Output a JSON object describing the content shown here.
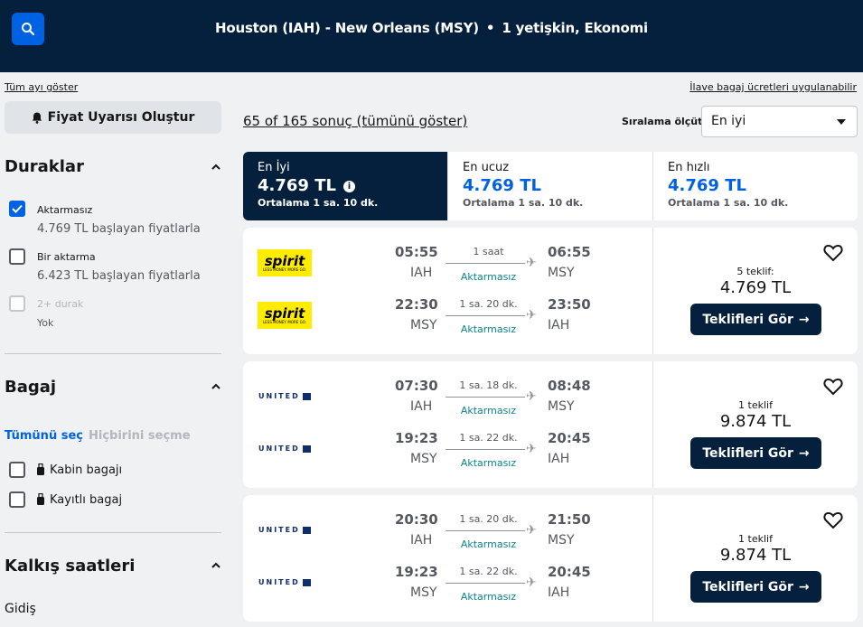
{
  "header": {
    "route": "Houston (IAH) - New Orleans (MSY)",
    "passengers": "1 yetişkin, Ekonomi"
  },
  "sidebar": {
    "show_month": "Tüm ayı göster",
    "alert_button": "Fiyat Uyarısı Oluştur",
    "stops_title": "Duraklar",
    "stops": [
      {
        "label": "Aktarmasız",
        "sub": "4.769 TL başlayan fiyatlarla",
        "checked": true
      },
      {
        "label": "Bir aktarma",
        "sub": "6.423 TL başlayan fiyatlarla",
        "checked": false
      },
      {
        "label": "2+ durak",
        "sub": "Yok",
        "checked": false,
        "disabled": true
      }
    ],
    "baggage_title": "Bagaj",
    "select_all": "Tümünü seç",
    "select_none": "Hiçbirini seçme",
    "baggage": [
      {
        "label": "Kabin bagajı"
      },
      {
        "label": "Kayıtlı bagaj"
      }
    ],
    "departure_title": "Kalkış saatleri",
    "departure_sub": "Gidiş"
  },
  "results": {
    "extra_fees": "İlave bagaj ücretleri uygulanabilir",
    "count": "65 of 165 sonuç (tümünü göster)",
    "sort_label": "Sıralama ölçütü",
    "sort_value": "En iyi"
  },
  "tabs": [
    {
      "label": "En İyi",
      "price": "4.769 TL",
      "avg": "Ortalama 1 sa. 10 dk."
    },
    {
      "label": "En ucuz",
      "price": "4.769 TL",
      "avg": "Ortalama 1 sa. 10 dk."
    },
    {
      "label": "En hızlı",
      "price": "4.769 TL",
      "avg": "Ortalama 1 sa. 10 dk."
    }
  ],
  "cards": [
    {
      "offers": "5 teklif:",
      "price": "4.769 TL",
      "cta": "Teklifleri Gör",
      "legs": [
        {
          "airline": "spirit",
          "dep": "05:55",
          "from": "IAH",
          "dur": "1 saat",
          "stops": "Aktarmasız",
          "arr": "06:55",
          "to": "MSY"
        },
        {
          "airline": "spirit",
          "dep": "22:30",
          "from": "MSY",
          "dur": "1 sa. 20 dk.",
          "stops": "Aktarmasız",
          "arr": "23:50",
          "to": "IAH"
        }
      ]
    },
    {
      "offers": "1 teklif",
      "price": "9.874 TL",
      "cta": "Teklifleri Gör",
      "legs": [
        {
          "airline": "united",
          "dep": "07:30",
          "from": "IAH",
          "dur": "1 sa. 18 dk.",
          "stops": "Aktarmasız",
          "arr": "08:48",
          "to": "MSY"
        },
        {
          "airline": "united",
          "dep": "19:23",
          "from": "MSY",
          "dur": "1 sa. 22 dk.",
          "stops": "Aktarmasız",
          "arr": "20:45",
          "to": "IAH"
        }
      ]
    },
    {
      "offers": "1 teklif",
      "price": "9.874 TL",
      "cta": "Teklifleri Gör",
      "legs": [
        {
          "airline": "united",
          "dep": "20:30",
          "from": "IAH",
          "dur": "1 sa. 20 dk.",
          "stops": "Aktarmasız",
          "arr": "21:50",
          "to": "MSY"
        },
        {
          "airline": "united",
          "dep": "19:23",
          "from": "MSY",
          "dur": "1 sa. 22 dk.",
          "stops": "Aktarmasız",
          "arr": "20:45",
          "to": "IAH"
        }
      ]
    }
  ],
  "logos": {
    "spirit": {
      "word": "spirit",
      "tagline": "LESS MONEY. MORE GO."
    },
    "united": {
      "word": "UNITED"
    }
  },
  "colors": {
    "navy": "#05203c",
    "blue": "#0062e3",
    "teal": "#0c838a",
    "spirit_yellow": "#ffec00"
  }
}
